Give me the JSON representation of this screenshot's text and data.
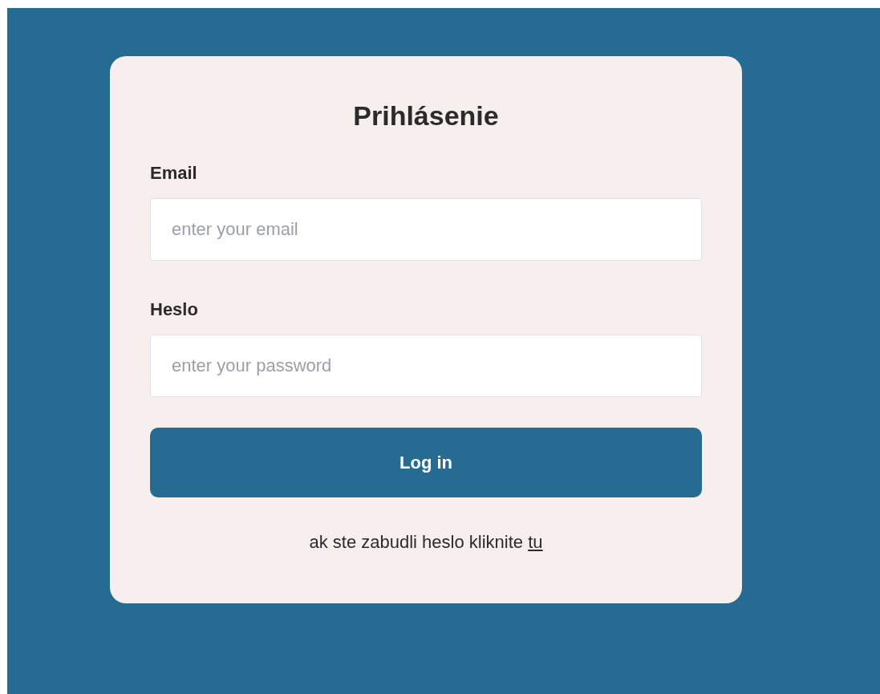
{
  "title": "Prihlásenie",
  "fields": [
    {
      "label": "Email",
      "placeholder": "enter your email"
    },
    {
      "label": "Heslo",
      "placeholder": "enter your password"
    }
  ],
  "button": "Log in",
  "forgot": {
    "text": "ak ste zabudli heslo kliknite",
    "link": "tu"
  }
}
